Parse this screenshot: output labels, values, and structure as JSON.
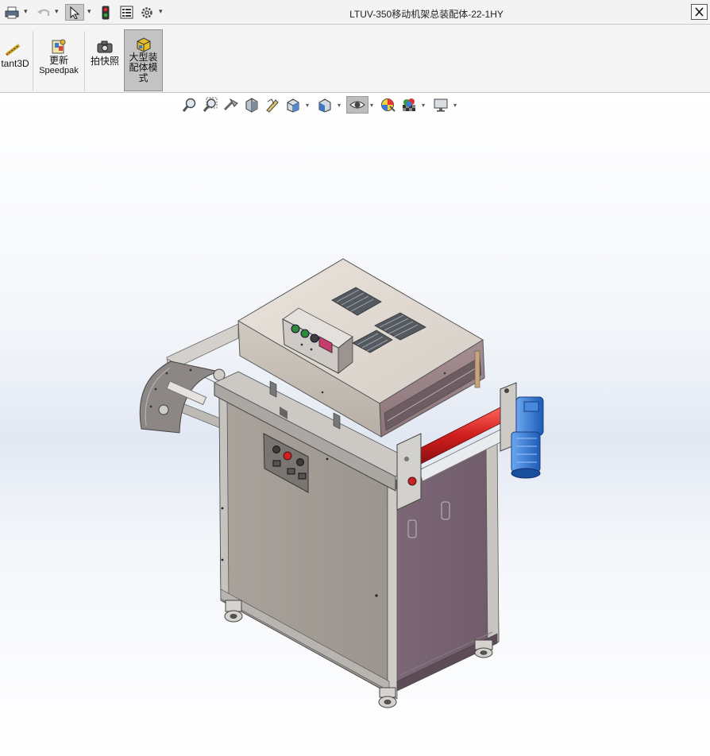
{
  "window": {
    "title": "LTUV-350移动机架总装配体-22-1HY",
    "close_label": "X"
  },
  "quick_access": {
    "icons": [
      "print-icon",
      "undo-icon",
      "select-icon",
      "rebuild-icon",
      "file-properties-icon",
      "options-icon"
    ]
  },
  "ribbon": {
    "instant3d": {
      "label": "tant3D"
    },
    "update_speedpak": {
      "line1": "更新",
      "line2": "Speedpak"
    },
    "take_snapshot": {
      "label": "拍快照"
    },
    "large_assembly": {
      "line1": "大型装",
      "line2": "配体模",
      "line3": "式"
    }
  },
  "heads_up_toolbar": {
    "icons": [
      "zoom-to-fit-icon",
      "zoom-to-area-icon",
      "previous-view-icon",
      "section-view-icon",
      "dynamic-annotation-icon",
      "view-orientation-icon",
      "display-style-icon",
      "hide-show-items-icon",
      "edit-appearance-icon",
      "apply-scene-icon",
      "view-settings-icon"
    ]
  },
  "colors": {
    "accent_red": "#d42020",
    "motor_blue": "#2a76d6",
    "panel_gray": "#aaa39b",
    "side_purple": "#7c6472"
  }
}
